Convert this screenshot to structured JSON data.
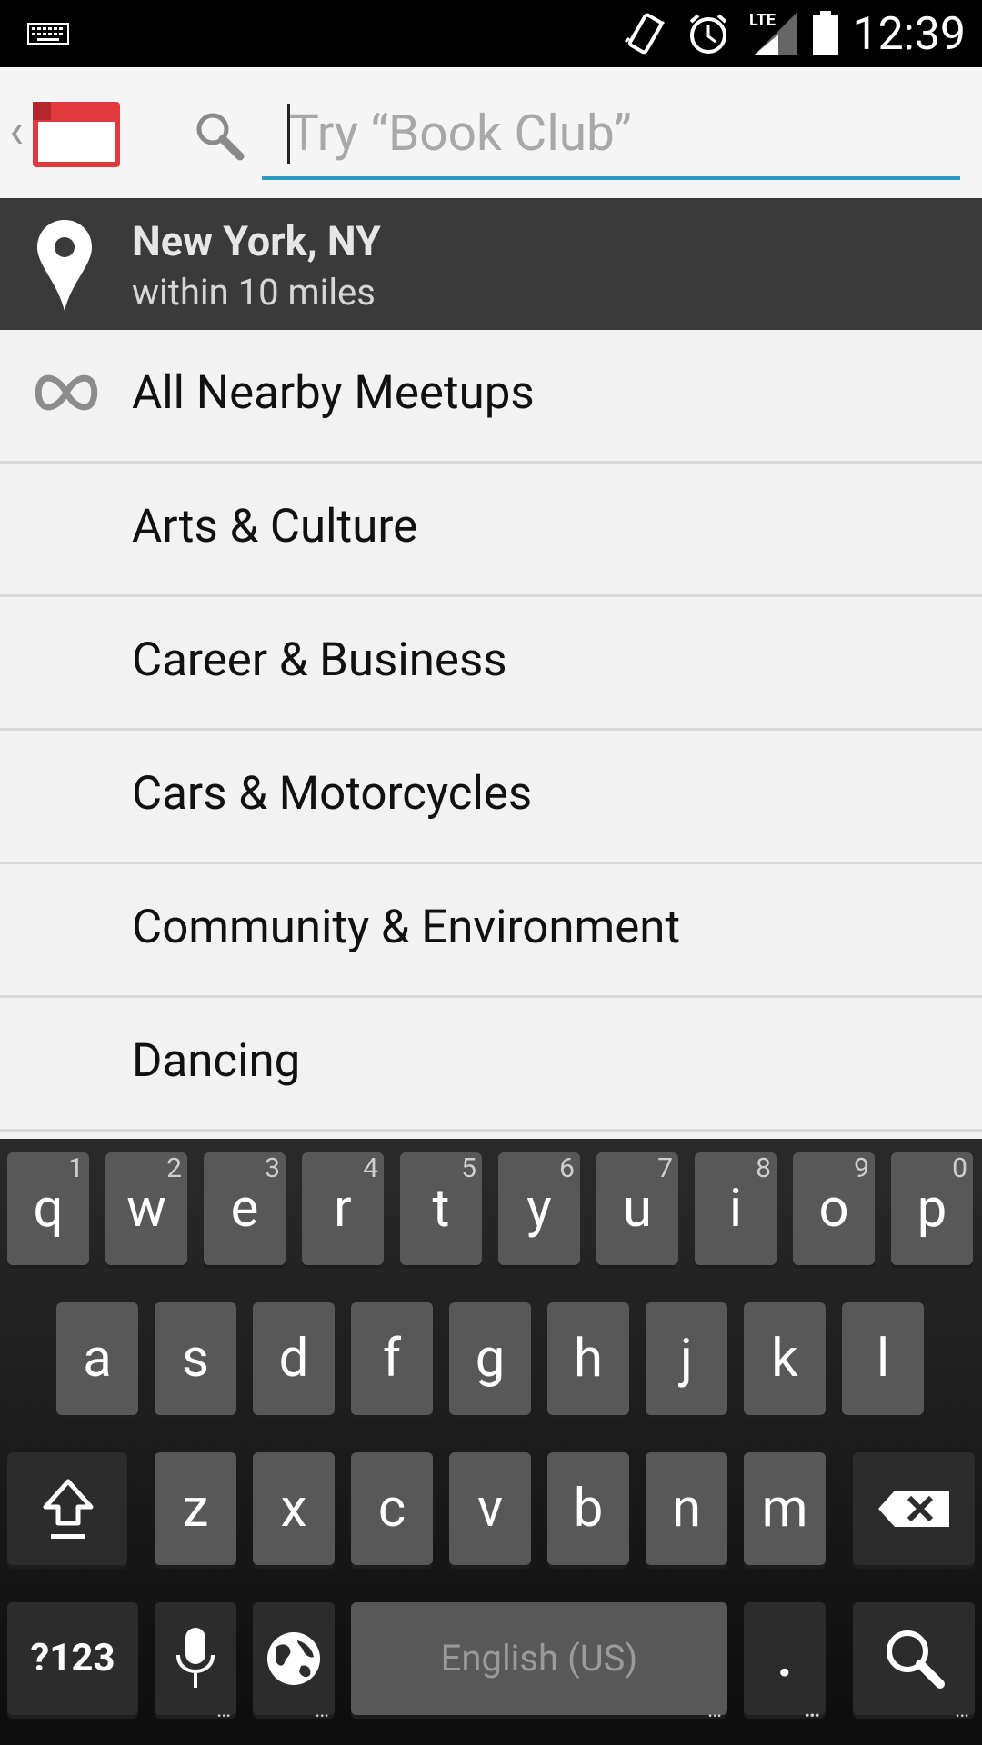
{
  "status_bar": {
    "time": "12:39",
    "network_label": "LTE",
    "icons": [
      "keyboard-icon",
      "vibrate-icon",
      "alarm-icon",
      "signal-icon",
      "battery-icon"
    ]
  },
  "action_bar": {
    "back_glyph": "‹",
    "search_placeholder": "Try “Book Club”"
  },
  "location": {
    "city": "New York, NY",
    "radius": "within 10 miles"
  },
  "list": {
    "items": [
      {
        "label": "All Nearby Meetups"
      },
      {
        "label": "Arts & Culture"
      },
      {
        "label": "Career & Business"
      },
      {
        "label": "Cars & Motorcycles"
      },
      {
        "label": "Community & Environment"
      },
      {
        "label": "Dancing"
      }
    ]
  },
  "keyboard": {
    "row1": [
      "q",
      "w",
      "e",
      "r",
      "t",
      "y",
      "u",
      "i",
      "o",
      "p"
    ],
    "row1_nums": [
      "1",
      "2",
      "3",
      "4",
      "5",
      "6",
      "7",
      "8",
      "9",
      "0"
    ],
    "row2": [
      "a",
      "s",
      "d",
      "f",
      "g",
      "h",
      "j",
      "k",
      "l"
    ],
    "row3": [
      "z",
      "x",
      "c",
      "v",
      "b",
      "n",
      "m"
    ],
    "symbols_label": "?123",
    "space_label": "English (US)",
    "period_label": "."
  },
  "colors": {
    "accent": "#2d9bc8",
    "brand_red": "#e0393e",
    "location_bar": "#3a3a3a"
  }
}
